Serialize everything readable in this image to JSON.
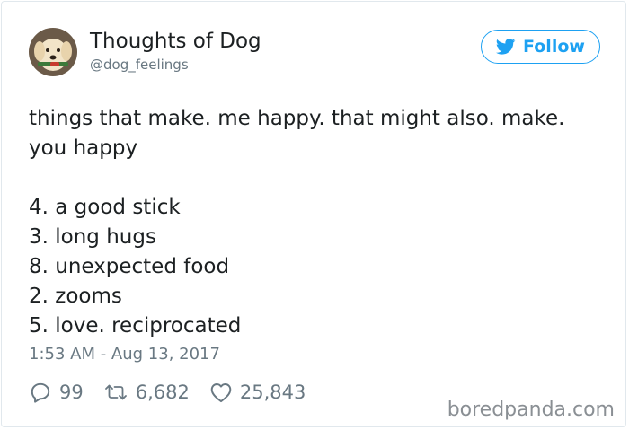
{
  "author": {
    "display_name": "Thoughts of Dog",
    "handle": "@dog_feelings"
  },
  "follow": {
    "label": "Follow",
    "icon": "twitter-bird-icon",
    "color": "#1da1f2"
  },
  "tweet": {
    "intro_lines": [
      "things that make. me happy. that might also. make.",
      "you happy"
    ],
    "list_items": [
      "4. a good stick",
      "3. long hugs",
      "8. unexpected food",
      "2. zooms",
      "5. love. reciprocated"
    ],
    "timestamp": "1:53 AM - Aug 13, 2017"
  },
  "actions": {
    "replies": "99",
    "retweets": "6,682",
    "likes": "25,843"
  },
  "watermark": "boredpanda.com"
}
